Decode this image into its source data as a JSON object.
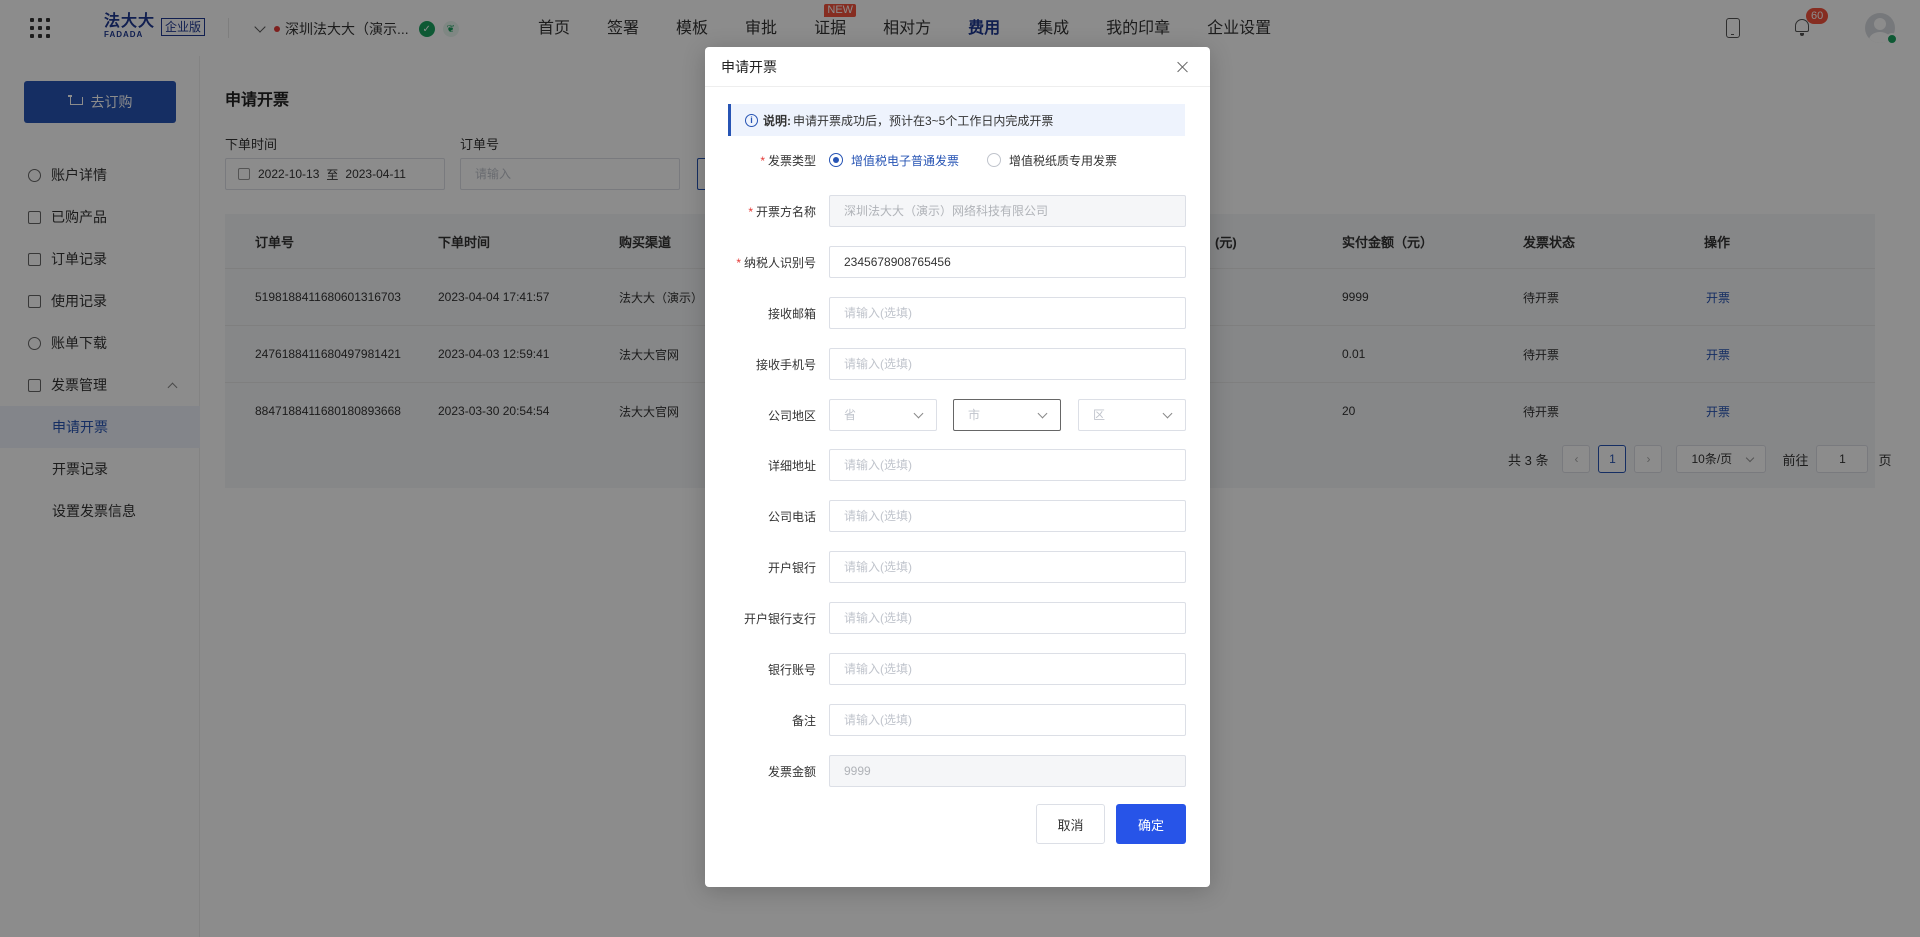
{
  "header": {
    "logo_cn": "法大大",
    "logo_en": "FADADA",
    "edition": "企业版",
    "company": "深圳法大大（演示...",
    "nav": [
      {
        "label": "首页"
      },
      {
        "label": "签署"
      },
      {
        "label": "模板"
      },
      {
        "label": "审批"
      },
      {
        "label": "证据",
        "tag": "NEW"
      },
      {
        "label": "相对方"
      },
      {
        "label": "费用"
      },
      {
        "label": "集成"
      },
      {
        "label": "我的印章"
      },
      {
        "label": "企业设置"
      }
    ],
    "notification_count": "60"
  },
  "sidebar": {
    "buy_button": "去订购",
    "items": [
      {
        "label": "账户详情"
      },
      {
        "label": "已购产品"
      },
      {
        "label": "订单记录"
      },
      {
        "label": "使用记录"
      },
      {
        "label": "账单下载"
      },
      {
        "label": "发票管理"
      }
    ],
    "sub_items": [
      {
        "label": "申请开票"
      },
      {
        "label": "开票记录"
      },
      {
        "label": "设置发票信息"
      }
    ]
  },
  "main": {
    "title": "申请开票",
    "filter": {
      "date_label": "下单时间",
      "date_start": "2022-10-13",
      "date_sep": "至",
      "date_end": "2023-04-11",
      "order_label": "订单号",
      "order_placeholder": "请输入"
    },
    "table": {
      "columns": [
        "订单号",
        "下单时间",
        "购买渠道",
        "(元)",
        "实付金额（元）",
        "发票状态",
        "操作"
      ],
      "rows": [
        {
          "order_no": "5198188411680601316703",
          "time": "2023-04-04 17:41:57",
          "channel": "法大大（演示）",
          "paid": "9999",
          "status": "待开票",
          "action": "开票"
        },
        {
          "order_no": "2476188411680497981421",
          "time": "2023-04-03 12:59:41",
          "channel": "法大大官网",
          "paid": "0.01",
          "status": "待开票",
          "action": "开票"
        },
        {
          "order_no": "8847188411680180893668",
          "time": "2023-03-30 20:54:54",
          "channel": "法大大官网",
          "paid": "20",
          "status": "待开票",
          "action": "开票"
        }
      ]
    },
    "pager": {
      "total": "共 3 条",
      "current": "1",
      "page_size": "10条/页",
      "goto_label": "前往",
      "goto_value": "1",
      "page_unit": "页"
    }
  },
  "modal": {
    "title": "申请开票",
    "notice_strong": "说明:",
    "notice_text": "申请开票成功后，预计在3~5个工作日内完成开票",
    "invoice_type_label": "发票类型",
    "invoice_type_options": [
      "增值税电子普通发票",
      "增值税纸质专用发票"
    ],
    "fields": {
      "issuer_label": "开票方名称",
      "issuer_value": "深圳法大大（演示）网络科技有限公司",
      "tax_id_label": "纳税人识别号",
      "tax_id_value": "2345678908765456",
      "email_label": "接收邮箱",
      "phone_label": "接收手机号",
      "region_label": "公司地区",
      "province": "省",
      "city": "市",
      "district": "区",
      "address_label": "详细地址",
      "company_phone_label": "公司电话",
      "bank_label": "开户银行",
      "branch_label": "开户银行支行",
      "account_label": "银行账号",
      "remark_label": "备注",
      "amount_label": "发票金额",
      "amount_value": "9999",
      "optional_placeholder": "请输入(选填)"
    },
    "cancel": "取消",
    "confirm": "确定"
  }
}
